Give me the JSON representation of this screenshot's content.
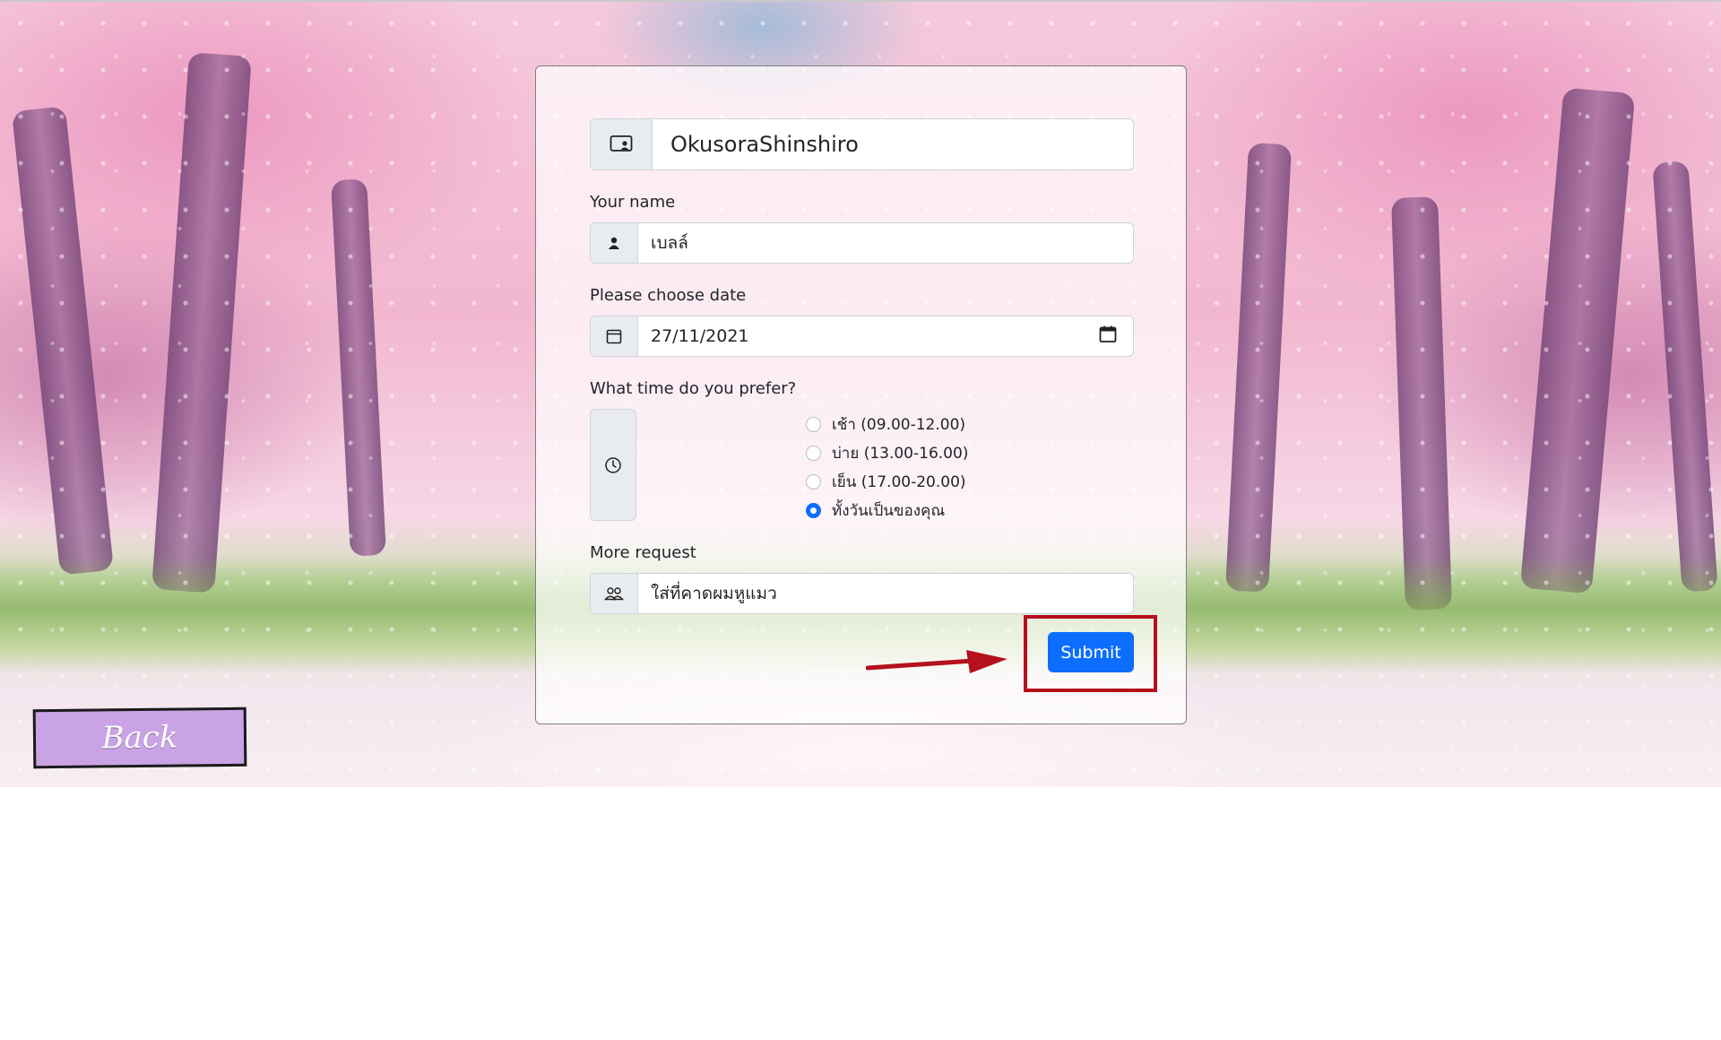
{
  "form": {
    "username": "OkusoraShinshiro",
    "name_label": "Your name",
    "name_value": "เบลล์",
    "date_label": "Please choose date",
    "date_value": "27/11/2021",
    "time_label": "What time do you prefer?",
    "time_options": [
      {
        "label": "เช้า (09.00-12.00)",
        "selected": false
      },
      {
        "label": "บ่าย (13.00-16.00)",
        "selected": false
      },
      {
        "label": "เย็น (17.00-20.00)",
        "selected": false
      },
      {
        "label": "ทั้งวันเป็นของคุณ",
        "selected": true
      }
    ],
    "request_label": "More request",
    "request_value": "ใส่ที่คาดผมหูแมว",
    "submit_label": "Submit"
  },
  "nav": {
    "back_label": "Back"
  },
  "icons": {
    "username": "profile-card-icon",
    "name": "person-icon",
    "date": "calendar-icon",
    "date_picker": "calendar-picker-icon",
    "time": "clock-icon",
    "request": "people-icon"
  },
  "colors": {
    "primary": "#0d6efd",
    "highlight": "#b5101d",
    "back_button": "#c9a3e4"
  }
}
